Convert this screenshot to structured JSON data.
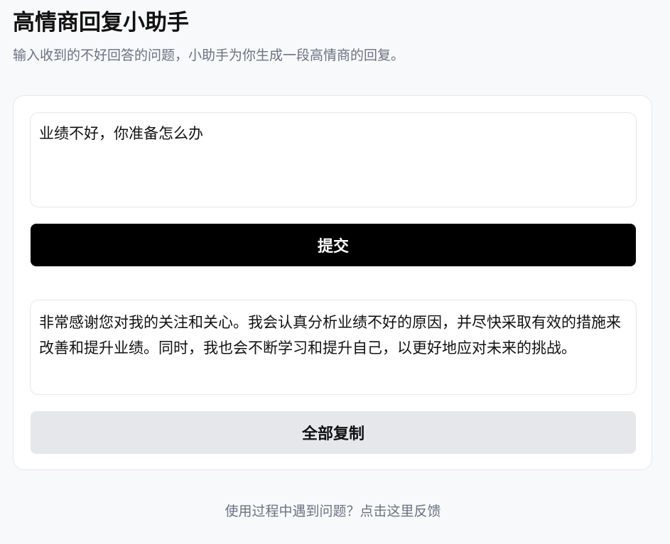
{
  "header": {
    "title": "高情商回复小助手",
    "subtitle": "输入收到的不好回答的问题，小助手为你生成一段高情商的回复。"
  },
  "form": {
    "question_value": "业绩不好，你准备怎么办",
    "submit_label": "提交"
  },
  "result": {
    "answer_text": "非常感谢您对我的关注和关心。我会认真分析业绩不好的原因，并尽快采取有效的措施来改善和提升业绩。同时，我也会不断学习和提升自己，以更好地应对未来的挑战。",
    "copy_label": "全部复制"
  },
  "footer": {
    "feedback_link": "使用过程中遇到问题？点击这里反馈"
  },
  "colors": {
    "background": "#f8f9fb",
    "card_border": "#e5e7eb",
    "primary_button": "#000000",
    "secondary_button": "#e5e7eb",
    "muted_text": "#6b7280"
  }
}
